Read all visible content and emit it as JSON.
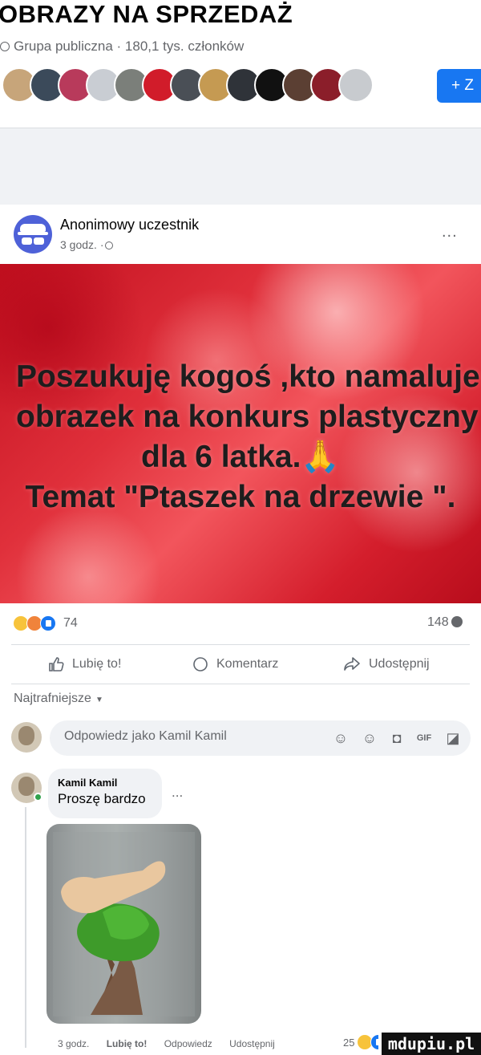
{
  "group": {
    "name": "OBRAZY NA SPRZEDAŻ",
    "meta": "Grupa publiczna · 180,1 tys. członków",
    "invite_label": "+ Z",
    "member_avatar_colors": [
      "#c7a57a",
      "#3b4a5a",
      "#b83a5b",
      "#c9cdd3",
      "#7b7f7a",
      "#d11c2a",
      "#4a4f56",
      "#c59a52",
      "#2f3339",
      "#111111",
      "#5b3f33",
      "#8b1e2a",
      "#c8cbcf"
    ]
  },
  "post": {
    "author": "Anonimowy uczestnik",
    "time": "3 godz. ·",
    "more": "...",
    "image_text": [
      "Poszukuję kogoś ,kto namaluje",
      "obrazek na konkurs plastyczny",
      "dla 6 latka.🙏",
      "Temat \"Ptaszek na drzewie \"."
    ],
    "reaction_count": "74",
    "comment_count": "148"
  },
  "actions": {
    "like": "Lubię to!",
    "comment": "Komentarz",
    "share": "Udostępnij"
  },
  "comments": {
    "sort": "Najtrafniejsze",
    "input_placeholder": "Odpowiedz jako Kamil Kamil",
    "items": [
      {
        "author": "Kamil Kamil",
        "text": "Proszę bardzo",
        "time": "3 godz.",
        "like": "Lubię to!",
        "reply": "Odpowiedz",
        "share": "Udostępnij",
        "reactions": "25"
      }
    ]
  },
  "watermark": "mdupiu.pl",
  "colors": {
    "accent": "#1877f2",
    "secondary_text": "#65676b",
    "post_bg_red": "#d41e2c"
  }
}
